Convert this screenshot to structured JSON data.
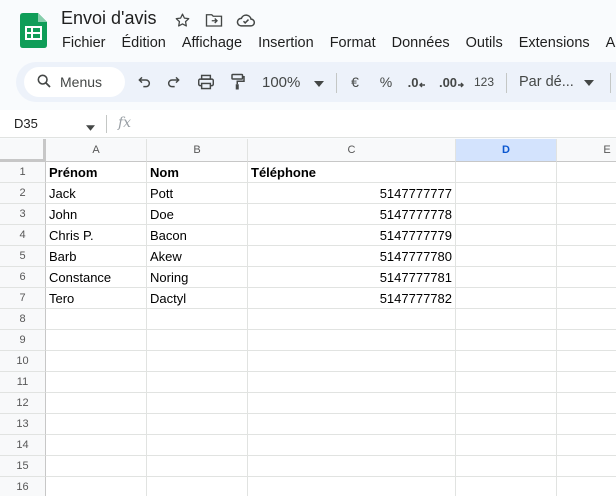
{
  "app": {
    "title": "Envoi d'avis",
    "icons": [
      "star-icon",
      "move-to-folder-icon",
      "cloud-saved-icon"
    ]
  },
  "menu": [
    "Fichier",
    "Édition",
    "Affichage",
    "Insertion",
    "Format",
    "Données",
    "Outils",
    "Extensions",
    "A"
  ],
  "toolbar": {
    "search_label": "Menus",
    "zoom": "100%",
    "currency": "€",
    "percent": "%",
    "decrease_decimal": ".0",
    "increase_decimal": ".00",
    "number_format": "123",
    "font": "Par dé..."
  },
  "formula_bar": {
    "cell_ref": "D35",
    "fx_label": "fx",
    "value": ""
  },
  "grid": {
    "columns": [
      "A",
      "B",
      "C",
      "D",
      "E"
    ],
    "selected_column": "D",
    "row_numbers": [
      "1",
      "2",
      "3",
      "4",
      "5",
      "6",
      "7",
      "8",
      "9",
      "10",
      "11",
      "12",
      "13",
      "14",
      "15",
      "16"
    ],
    "header_row": [
      "Prénom",
      "Nom",
      "Téléphone"
    ],
    "rows": [
      [
        "Jack",
        "Pott",
        "5147777777"
      ],
      [
        "John",
        "Doe",
        "5147777778"
      ],
      [
        "Chris P.",
        "Bacon",
        "5147777779"
      ],
      [
        "Barb",
        "Akew",
        "5147777780"
      ],
      [
        "Constance",
        "Noring",
        "5147777781"
      ],
      [
        "Tero",
        "Dactyl",
        "5147777782"
      ]
    ]
  },
  "colors": {
    "logo_green": "#0f9d58",
    "selection_blue": "#d3e3fd",
    "toolbar_bg": "#edf2fa"
  }
}
